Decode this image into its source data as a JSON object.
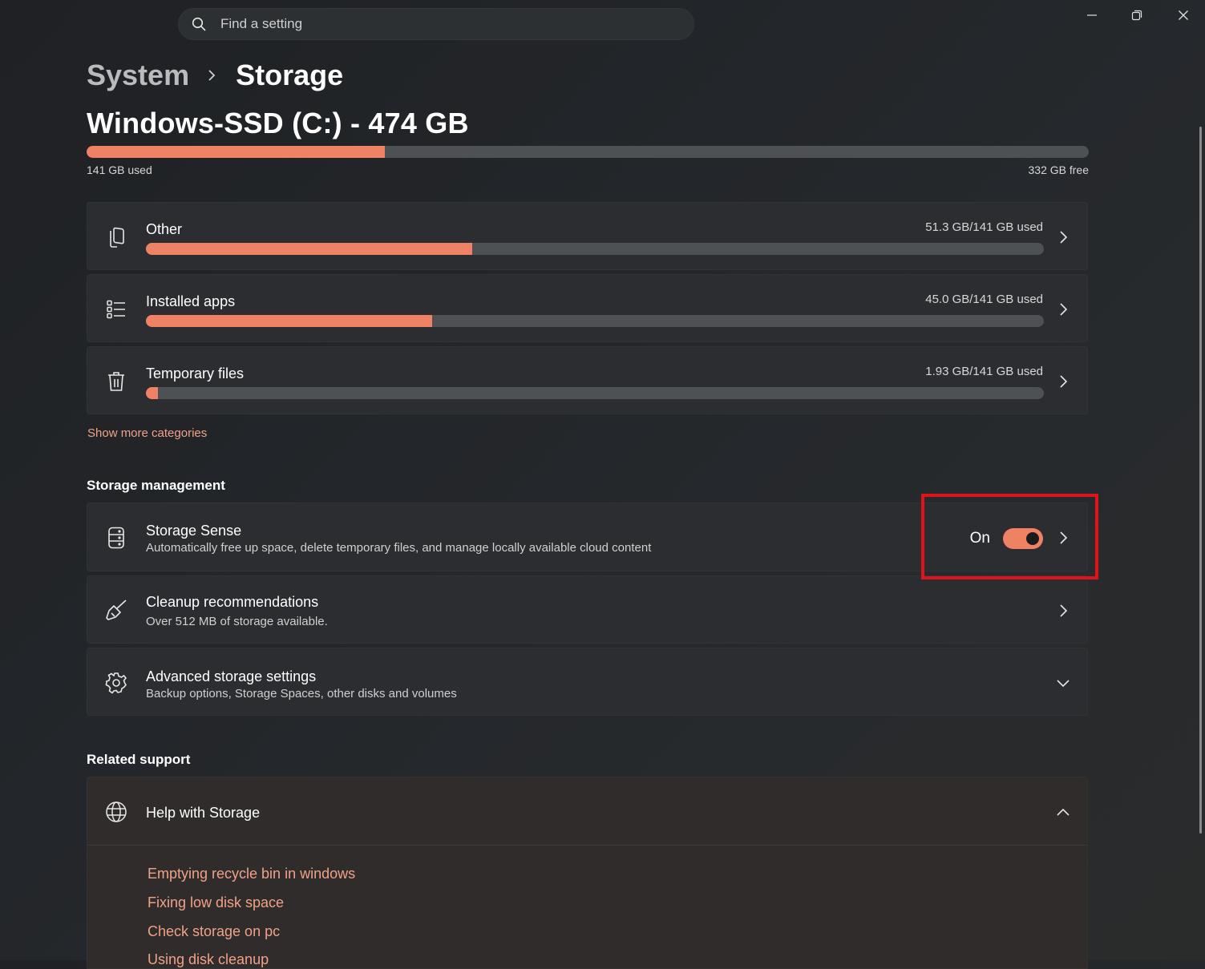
{
  "search": {
    "placeholder": "Find a setting",
    "icon": "search-icon"
  },
  "window_controls": {
    "minimize_icon": "minimize-icon",
    "restore_icon": "restore-icon",
    "close_icon": "close-icon"
  },
  "breadcrumb": {
    "parent": "System",
    "current": "Storage"
  },
  "drive": {
    "title": "Windows-SSD (C:) - 474 GB",
    "used_label": "141 GB used",
    "free_label": "332 GB free",
    "used_fraction": 0.2975
  },
  "categories": [
    {
      "label": "Other",
      "amount": "51.3 GB/141 GB used",
      "fraction": 0.3638,
      "icon": "document-icon"
    },
    {
      "label": "Installed apps",
      "amount": "45.0 GB/141 GB used",
      "fraction": 0.3191,
      "icon": "list-icon"
    },
    {
      "label": "Temporary files",
      "amount": "1.93 GB/141 GB used",
      "fraction": 0.0137,
      "icon": "trash-icon"
    }
  ],
  "show_more": "Show more categories",
  "storage_management": {
    "heading": "Storage management",
    "storage_sense": {
      "title": "Storage Sense",
      "subtitle": "Automatically free up space, delete temporary files, and manage locally available cloud content",
      "toggle_label": "On",
      "enabled": true
    },
    "cleanup": {
      "title": "Cleanup recommendations",
      "subtitle": "Over 512 MB of storage available."
    },
    "advanced": {
      "title": "Advanced storage settings",
      "subtitle": "Backup options, Storage Spaces, other disks and volumes"
    }
  },
  "related_support": {
    "heading": "Related support",
    "help_title": "Help with Storage",
    "links": [
      "Emptying recycle bin in windows",
      "Fixing low disk space",
      "Check storage on pc",
      "Using disk cleanup"
    ]
  },
  "colors": {
    "accent": "#ef8265",
    "highlight": "#e0121b",
    "track": "#4d5154",
    "link": "#f0a287"
  }
}
